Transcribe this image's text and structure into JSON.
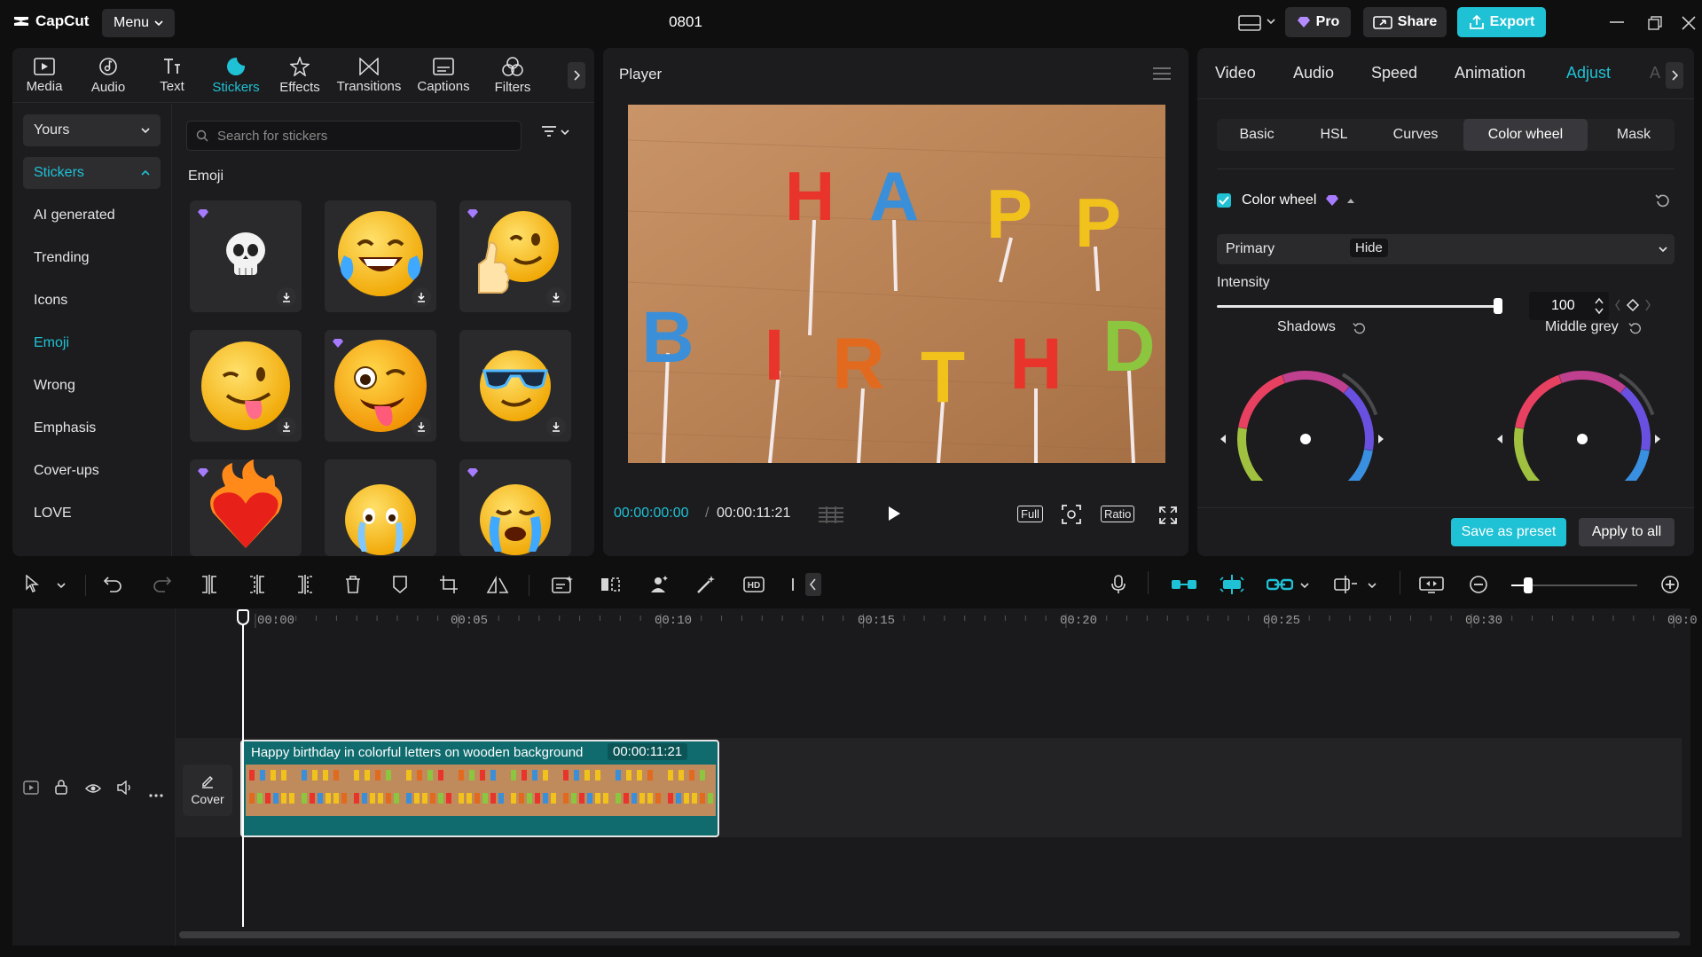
{
  "app": {
    "logo_text": "CapCut",
    "menu_label": "Menu",
    "doc_title": "0801",
    "pro_label": "Pro",
    "share_label": "Share",
    "export_label": "Export"
  },
  "left_panel": {
    "tabs": [
      {
        "label": "Media",
        "icon": "media-icon"
      },
      {
        "label": "Audio",
        "icon": "audio-icon"
      },
      {
        "label": "Text",
        "icon": "text-icon"
      },
      {
        "label": "Stickers",
        "icon": "stickers-icon",
        "active": true
      },
      {
        "label": "Effects",
        "icon": "effects-icon"
      },
      {
        "label": "Transitions",
        "icon": "transitions-icon"
      },
      {
        "label": "Captions",
        "icon": "captions-icon"
      },
      {
        "label": "Filters",
        "icon": "filters-icon"
      }
    ],
    "nav": [
      {
        "label": "Yours"
      },
      {
        "label": "Stickers"
      },
      {
        "label": "AI generated"
      },
      {
        "label": "Trending"
      },
      {
        "label": "Icons"
      },
      {
        "label": "Emoji"
      },
      {
        "label": "Wrong"
      },
      {
        "label": "Emphasis"
      },
      {
        "label": "Cover-ups"
      },
      {
        "label": "LOVE"
      }
    ],
    "search_placeholder": "Search for stickers",
    "section_label": "Emoji"
  },
  "player": {
    "title": "Player",
    "current_time": "00:00:00:00",
    "separator": "/",
    "total_time": "00:00:11:21",
    "full_label": "Full",
    "ratio_label": "Ratio",
    "video_letters": [
      "H",
      "A",
      "P",
      "P",
      "B",
      "I",
      "R",
      "T",
      "H",
      "D"
    ]
  },
  "right_panel": {
    "tabs": [
      "Video",
      "Audio",
      "Speed",
      "Animation",
      "Adjust"
    ],
    "truncated_tab": "A",
    "subtabs": [
      "Basic",
      "HSL",
      "Curves",
      "Color wheel",
      "Mask"
    ],
    "color_wheel_label": "Color wheel",
    "primary_label": "Primary",
    "hide_label": "Hide",
    "intensity_label": "Intensity",
    "intensity_value": "100",
    "intensity_fraction": 1.0,
    "shadows_label": "Shadows",
    "middle_grey_label": "Middle grey",
    "save_preset_label": "Save as preset",
    "apply_all_label": "Apply to all"
  },
  "timeline": {
    "ruler": [
      "00:00",
      "00:05",
      "00:10",
      "00:15",
      "00:20",
      "00:25",
      "00:30",
      "00:0"
    ],
    "clip_title": "Happy birthday in colorful letters on wooden background",
    "clip_duration": "00:00:11:21",
    "cover_label": "Cover"
  },
  "colors": {
    "accent": "#1fc1d4",
    "panel": "#1c1c1e",
    "background": "#0f0f10",
    "clip": "#0f6b6e"
  }
}
